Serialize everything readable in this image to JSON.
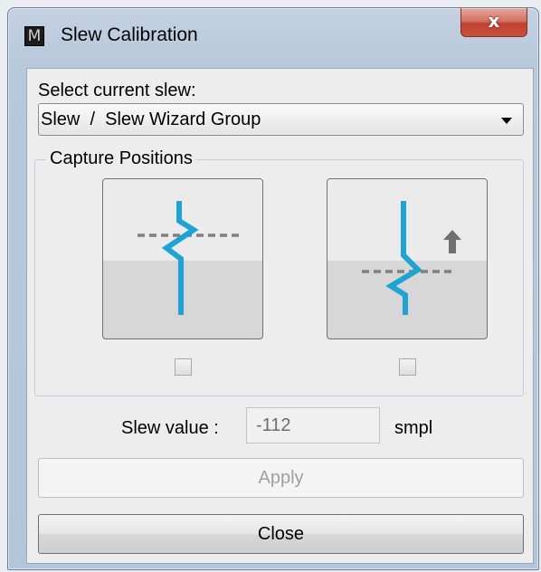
{
  "window": {
    "title": "Slew Calibration",
    "app_icon_letter": "M",
    "close_glyph": "x"
  },
  "slew_select": {
    "label": "Select current slew:",
    "selected": "Slew  /  Slew Wizard Group"
  },
  "capture": {
    "legend": "Capture Positions",
    "buttons": [
      {
        "icon": "slew-position-1-icon",
        "checked": false
      },
      {
        "icon": "slew-position-2-up-icon",
        "checked": false
      }
    ]
  },
  "slew_value": {
    "label": "Slew value :",
    "value": "-112",
    "unit": "smpl"
  },
  "actions": {
    "apply_label": "Apply",
    "apply_enabled": false,
    "close_label": "Close"
  },
  "colors": {
    "icon_line": "#1ea3d4",
    "dashed_line": "#808080",
    "arrow": "#707070"
  }
}
